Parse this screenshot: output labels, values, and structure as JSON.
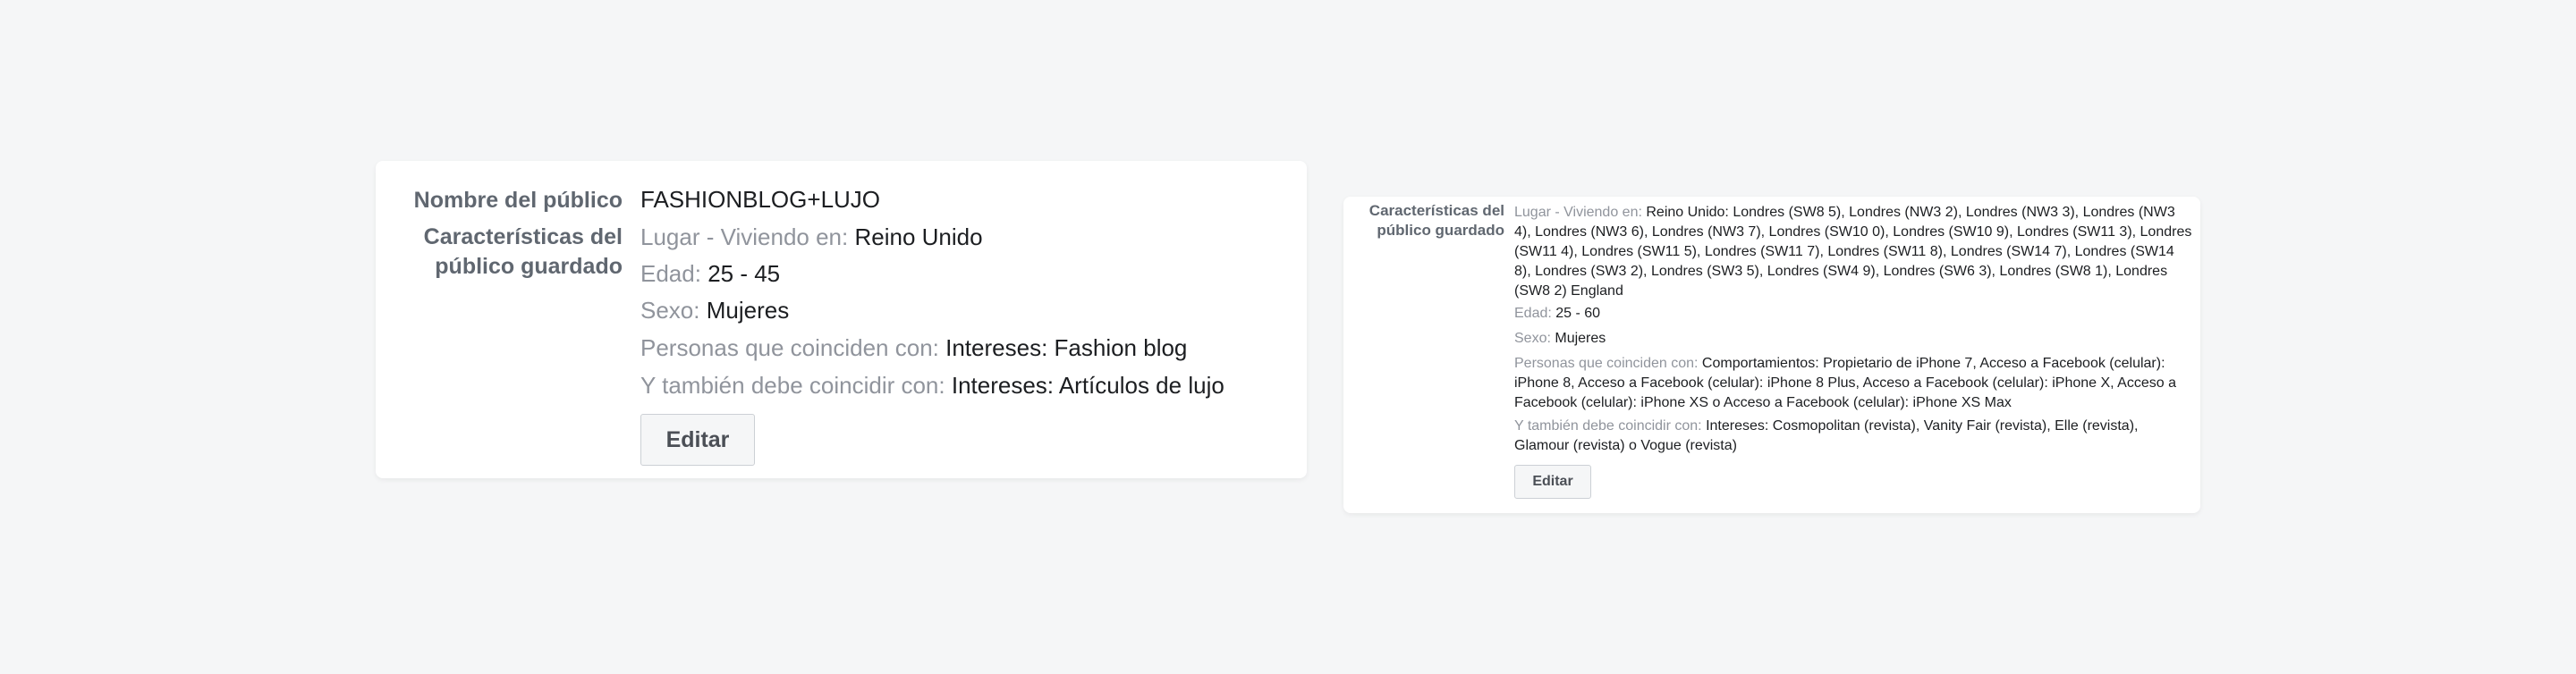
{
  "card1": {
    "audience_name_label": "Nombre del público",
    "audience_name": "FASHIONBLOG+LUJO",
    "characteristics_label": "Características del público guardado",
    "location_label": "Lugar - Viviendo en:",
    "location_value": "Reino Unido",
    "age_label": "Edad:",
    "age_value": "25 - 45",
    "sex_label": "Sexo:",
    "sex_value": "Mujeres",
    "persons_label": "Personas que coinciden con:",
    "persons_value": "Intereses: Fashion blog",
    "also_label": "Y también debe coincidir con:",
    "also_value": "Intereses: Artículos de lujo",
    "edit_button": "Editar"
  },
  "card2": {
    "characteristics_label": "Características del público guardado",
    "location_label": "Lugar - Viviendo en:",
    "location_value": "Reino Unido: Londres (SW8 5), Londres (NW3 2), Londres (NW3 3), Londres (NW3 4), Londres (NW3 6), Londres (NW3 7), Londres (SW10 0), Londres (SW10 9), Londres (SW11 3), Londres (SW11 4), Londres (SW11 5), Londres (SW11 7), Londres (SW11 8), Londres (SW14 7), Londres (SW14 8), Londres (SW3 2), Londres (SW3 5), Londres (SW4 9), Londres (SW6 3), Londres (SW8 1), Londres (SW8 2) England",
    "age_label": "Edad:",
    "age_value": "25 - 60",
    "sex_label": "Sexo:",
    "sex_value": "Mujeres",
    "persons_label": "Personas que coinciden con:",
    "persons_value": "Comportamientos: Propietario de iPhone 7, Acceso a Facebook (celular): iPhone 8, Acceso a Facebook (celular): iPhone 8 Plus, Acceso a Facebook (celular): iPhone X, Acceso a Facebook (celular): iPhone XS o Acceso a Facebook (celular): iPhone XS Max",
    "also_label": "Y también debe coincidir con:",
    "also_value": "Intereses: Cosmopolitan (revista), Vanity Fair (revista), Elle (revista), Glamour (revista) o Vogue (revista)",
    "edit_button": "Editar"
  },
  "colors": {
    "background": "#f5f6f7",
    "card": "#ffffff",
    "label": "#606770",
    "muted": "#90949c",
    "text": "#1c1e21"
  }
}
